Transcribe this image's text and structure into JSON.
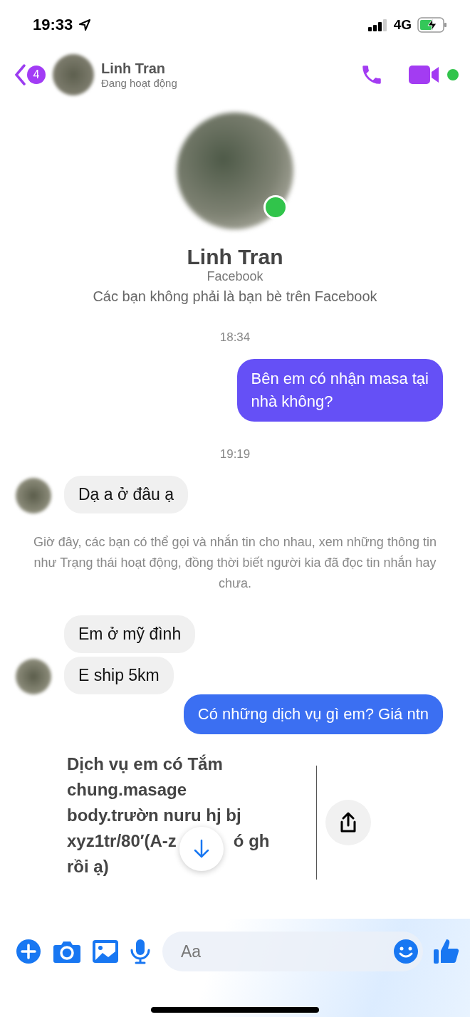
{
  "status_bar": {
    "time": "19:33",
    "network": "4G"
  },
  "header": {
    "back_count": "4",
    "name": "Linh Tran",
    "subtitle": "Đang hoạt động",
    "online": true
  },
  "profile": {
    "name": "Linh Tran",
    "source": "Facebook",
    "note": "Các bạn không phải là bạn bè trên Facebook",
    "online": true
  },
  "messages": [
    {
      "kind": "time",
      "text": "18:34"
    },
    {
      "kind": "sent",
      "lines": [
        "Bên em có nhận masa tại",
        "nhà không?"
      ],
      "color": "#6550f6"
    },
    {
      "kind": "time",
      "text": "19:19"
    },
    {
      "kind": "received",
      "texts": [
        "Dạ a ở đâu ạ"
      ]
    },
    {
      "kind": "notice",
      "text": "Giờ đây, các bạn có thể gọi và nhắn tin cho nhau, xem những thông tin như Trạng thái hoạt động, đồng thời biết người kia đã đọc tin nhắn hay chưa."
    },
    {
      "kind": "received",
      "texts": [
        "Em ở mỹ đình",
        "E ship 5km"
      ]
    },
    {
      "kind": "sent",
      "lines": [
        "Có những dịch vụ gì em? Giá ntn"
      ],
      "color": "#3b6ff2"
    },
    {
      "kind": "shared",
      "lines": [
        [
          "Dịch vụ em có Tắm"
        ],
        [
          "chung.masage"
        ],
        [
          "body.trườn nuru hj bj"
        ],
        [
          "xyz1tr/80′(A-z",
          "ó gh"
        ],
        [
          "rồi ạ)"
        ]
      ]
    }
  ],
  "composer": {
    "placeholder": "Aa"
  }
}
